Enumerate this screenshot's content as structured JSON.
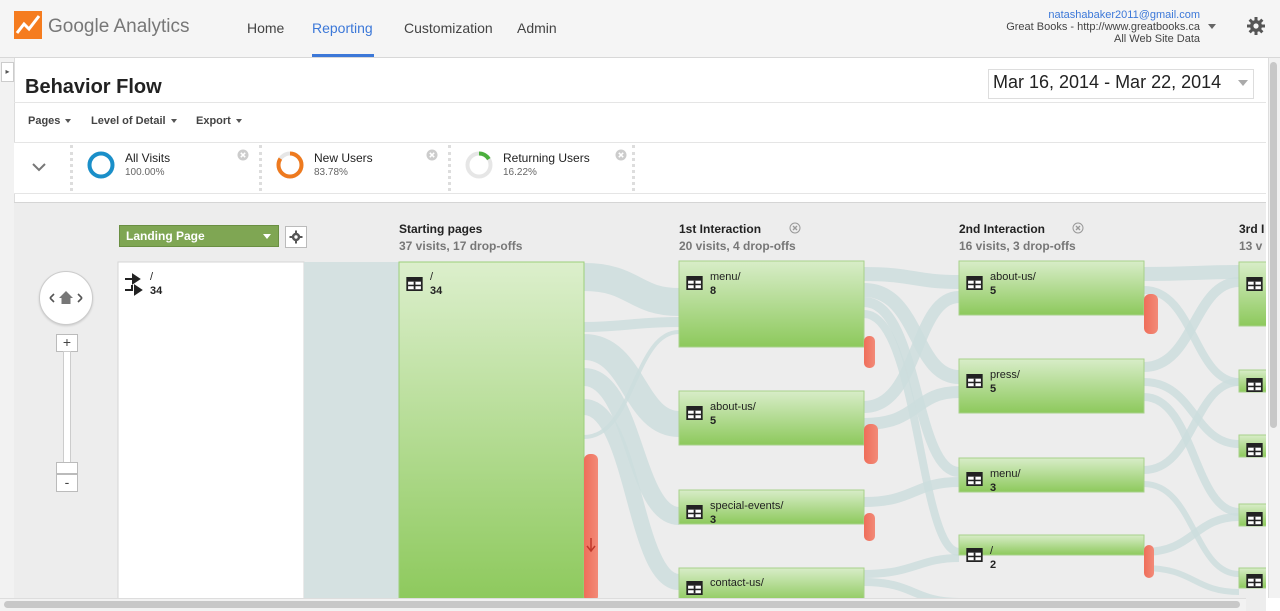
{
  "header": {
    "logo_text": "Google Analytics",
    "nav": [
      "Home",
      "Reporting",
      "Customization",
      "Admin"
    ],
    "active_nav": "Reporting",
    "account": {
      "email": "natashabaker2011@gmail.com",
      "property": "Great Books - http://www.greatbooks.ca",
      "view": "All Web Site Data"
    }
  },
  "page": {
    "title": "Behavior Flow",
    "date_range": "Mar 16, 2014 - Mar 22, 2014"
  },
  "toolbar": {
    "pages_label": "Pages",
    "level_label": "Level of Detail",
    "export_label": "Export"
  },
  "segments": [
    {
      "name": "All Visits",
      "pct": "100.00%",
      "color": "#1a8fc9",
      "fraction": 1.0
    },
    {
      "name": "New Users",
      "pct": "83.78%",
      "color": "#ee7a1f",
      "fraction": 0.8378
    },
    {
      "name": "Returning Users",
      "pct": "16.22%",
      "color": "#4caf3e",
      "fraction": 0.1622
    }
  ],
  "flow": {
    "dimension": "Landing Page",
    "columns": [
      {
        "title": "Starting pages",
        "sub": "37 visits, 17 drop-offs"
      },
      {
        "title": "1st Interaction",
        "sub": "20 visits, 4 drop-offs"
      },
      {
        "title": "2nd Interaction",
        "sub": "16 visits, 3 drop-offs"
      },
      {
        "title": "3rd I",
        "sub": "13 v"
      }
    ],
    "landing": {
      "label": "/",
      "count": "34"
    },
    "starting": {
      "label": "/",
      "count": "34"
    },
    "first": [
      {
        "label": "menu/",
        "count": "8"
      },
      {
        "label": "about-us/",
        "count": "5"
      },
      {
        "label": "special-events/",
        "count": "3"
      },
      {
        "label": "contact-us/",
        "count": ""
      }
    ],
    "second": [
      {
        "label": "about-us/",
        "count": "5"
      },
      {
        "label": "press/",
        "count": "5"
      },
      {
        "label": "menu/",
        "count": "3"
      },
      {
        "label": "/",
        "count": "2"
      }
    ],
    "colors": {
      "node": "#8dc95c",
      "dropoff": "#ef6e5a",
      "link": "#c9d9d9"
    }
  }
}
